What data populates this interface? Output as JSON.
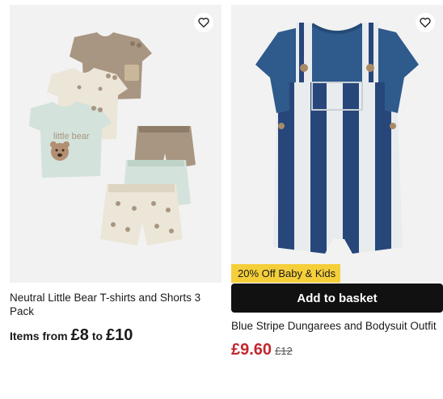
{
  "products": [
    {
      "title": "Neutral Little Bear T-shirts and Shorts 3 Pack",
      "price_prefix": "Items from",
      "price_from": "£8",
      "price_to_word": "to",
      "price_to": "£10",
      "wishlist_icon": "heart-outline-icon",
      "image_text": "little bear"
    },
    {
      "title": "Blue Stripe Dungarees and Bodysuit Outfit",
      "promo_badge": "20% Off Baby & Kids",
      "add_to_basket": "Add to basket",
      "price_now": "£9.60",
      "price_was": "£12",
      "wishlist_icon": "heart-outline-icon",
      "price_color": "#c0282d",
      "badge_color": "#f5cf3a"
    }
  ]
}
